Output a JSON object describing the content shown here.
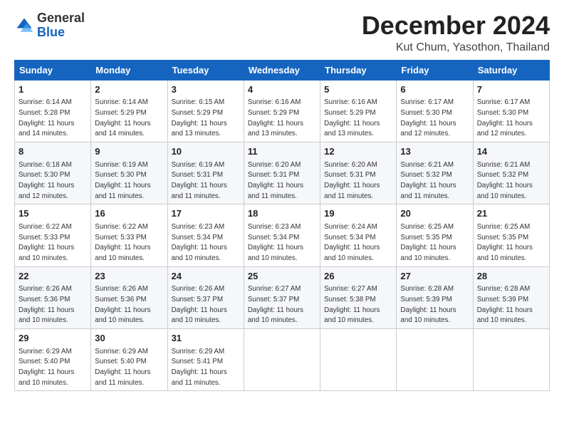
{
  "logo": {
    "general": "General",
    "blue": "Blue"
  },
  "title": "December 2024",
  "location": "Kut Chum, Yasothon, Thailand",
  "days_header": [
    "Sunday",
    "Monday",
    "Tuesday",
    "Wednesday",
    "Thursday",
    "Friday",
    "Saturday"
  ],
  "weeks": [
    [
      {
        "day": "1",
        "sunrise": "6:14 AM",
        "sunset": "5:28 PM",
        "daylight": "11 hours and 14 minutes."
      },
      {
        "day": "2",
        "sunrise": "6:14 AM",
        "sunset": "5:29 PM",
        "daylight": "11 hours and 14 minutes."
      },
      {
        "day": "3",
        "sunrise": "6:15 AM",
        "sunset": "5:29 PM",
        "daylight": "11 hours and 13 minutes."
      },
      {
        "day": "4",
        "sunrise": "6:16 AM",
        "sunset": "5:29 PM",
        "daylight": "11 hours and 13 minutes."
      },
      {
        "day": "5",
        "sunrise": "6:16 AM",
        "sunset": "5:29 PM",
        "daylight": "11 hours and 13 minutes."
      },
      {
        "day": "6",
        "sunrise": "6:17 AM",
        "sunset": "5:30 PM",
        "daylight": "11 hours and 12 minutes."
      },
      {
        "day": "7",
        "sunrise": "6:17 AM",
        "sunset": "5:30 PM",
        "daylight": "11 hours and 12 minutes."
      }
    ],
    [
      {
        "day": "8",
        "sunrise": "6:18 AM",
        "sunset": "5:30 PM",
        "daylight": "11 hours and 12 minutes."
      },
      {
        "day": "9",
        "sunrise": "6:19 AM",
        "sunset": "5:30 PM",
        "daylight": "11 hours and 11 minutes."
      },
      {
        "day": "10",
        "sunrise": "6:19 AM",
        "sunset": "5:31 PM",
        "daylight": "11 hours and 11 minutes."
      },
      {
        "day": "11",
        "sunrise": "6:20 AM",
        "sunset": "5:31 PM",
        "daylight": "11 hours and 11 minutes."
      },
      {
        "day": "12",
        "sunrise": "6:20 AM",
        "sunset": "5:31 PM",
        "daylight": "11 hours and 11 minutes."
      },
      {
        "day": "13",
        "sunrise": "6:21 AM",
        "sunset": "5:32 PM",
        "daylight": "11 hours and 11 minutes."
      },
      {
        "day": "14",
        "sunrise": "6:21 AM",
        "sunset": "5:32 PM",
        "daylight": "11 hours and 10 minutes."
      }
    ],
    [
      {
        "day": "15",
        "sunrise": "6:22 AM",
        "sunset": "5:33 PM",
        "daylight": "11 hours and 10 minutes."
      },
      {
        "day": "16",
        "sunrise": "6:22 AM",
        "sunset": "5:33 PM",
        "daylight": "11 hours and 10 minutes."
      },
      {
        "day": "17",
        "sunrise": "6:23 AM",
        "sunset": "5:34 PM",
        "daylight": "11 hours and 10 minutes."
      },
      {
        "day": "18",
        "sunrise": "6:23 AM",
        "sunset": "5:34 PM",
        "daylight": "11 hours and 10 minutes."
      },
      {
        "day": "19",
        "sunrise": "6:24 AM",
        "sunset": "5:34 PM",
        "daylight": "11 hours and 10 minutes."
      },
      {
        "day": "20",
        "sunrise": "6:25 AM",
        "sunset": "5:35 PM",
        "daylight": "11 hours and 10 minutes."
      },
      {
        "day": "21",
        "sunrise": "6:25 AM",
        "sunset": "5:35 PM",
        "daylight": "11 hours and 10 minutes."
      }
    ],
    [
      {
        "day": "22",
        "sunrise": "6:26 AM",
        "sunset": "5:36 PM",
        "daylight": "11 hours and 10 minutes."
      },
      {
        "day": "23",
        "sunrise": "6:26 AM",
        "sunset": "5:36 PM",
        "daylight": "11 hours and 10 minutes."
      },
      {
        "day": "24",
        "sunrise": "6:26 AM",
        "sunset": "5:37 PM",
        "daylight": "11 hours and 10 minutes."
      },
      {
        "day": "25",
        "sunrise": "6:27 AM",
        "sunset": "5:37 PM",
        "daylight": "11 hours and 10 minutes."
      },
      {
        "day": "26",
        "sunrise": "6:27 AM",
        "sunset": "5:38 PM",
        "daylight": "11 hours and 10 minutes."
      },
      {
        "day": "27",
        "sunrise": "6:28 AM",
        "sunset": "5:39 PM",
        "daylight": "11 hours and 10 minutes."
      },
      {
        "day": "28",
        "sunrise": "6:28 AM",
        "sunset": "5:39 PM",
        "daylight": "11 hours and 10 minutes."
      }
    ],
    [
      {
        "day": "29",
        "sunrise": "6:29 AM",
        "sunset": "5:40 PM",
        "daylight": "11 hours and 10 minutes."
      },
      {
        "day": "30",
        "sunrise": "6:29 AM",
        "sunset": "5:40 PM",
        "daylight": "11 hours and 11 minutes."
      },
      {
        "day": "31",
        "sunrise": "6:29 AM",
        "sunset": "5:41 PM",
        "daylight": "11 hours and 11 minutes."
      },
      null,
      null,
      null,
      null
    ]
  ],
  "labels": {
    "sunrise": "Sunrise:",
    "sunset": "Sunset:",
    "daylight": "Daylight:"
  }
}
